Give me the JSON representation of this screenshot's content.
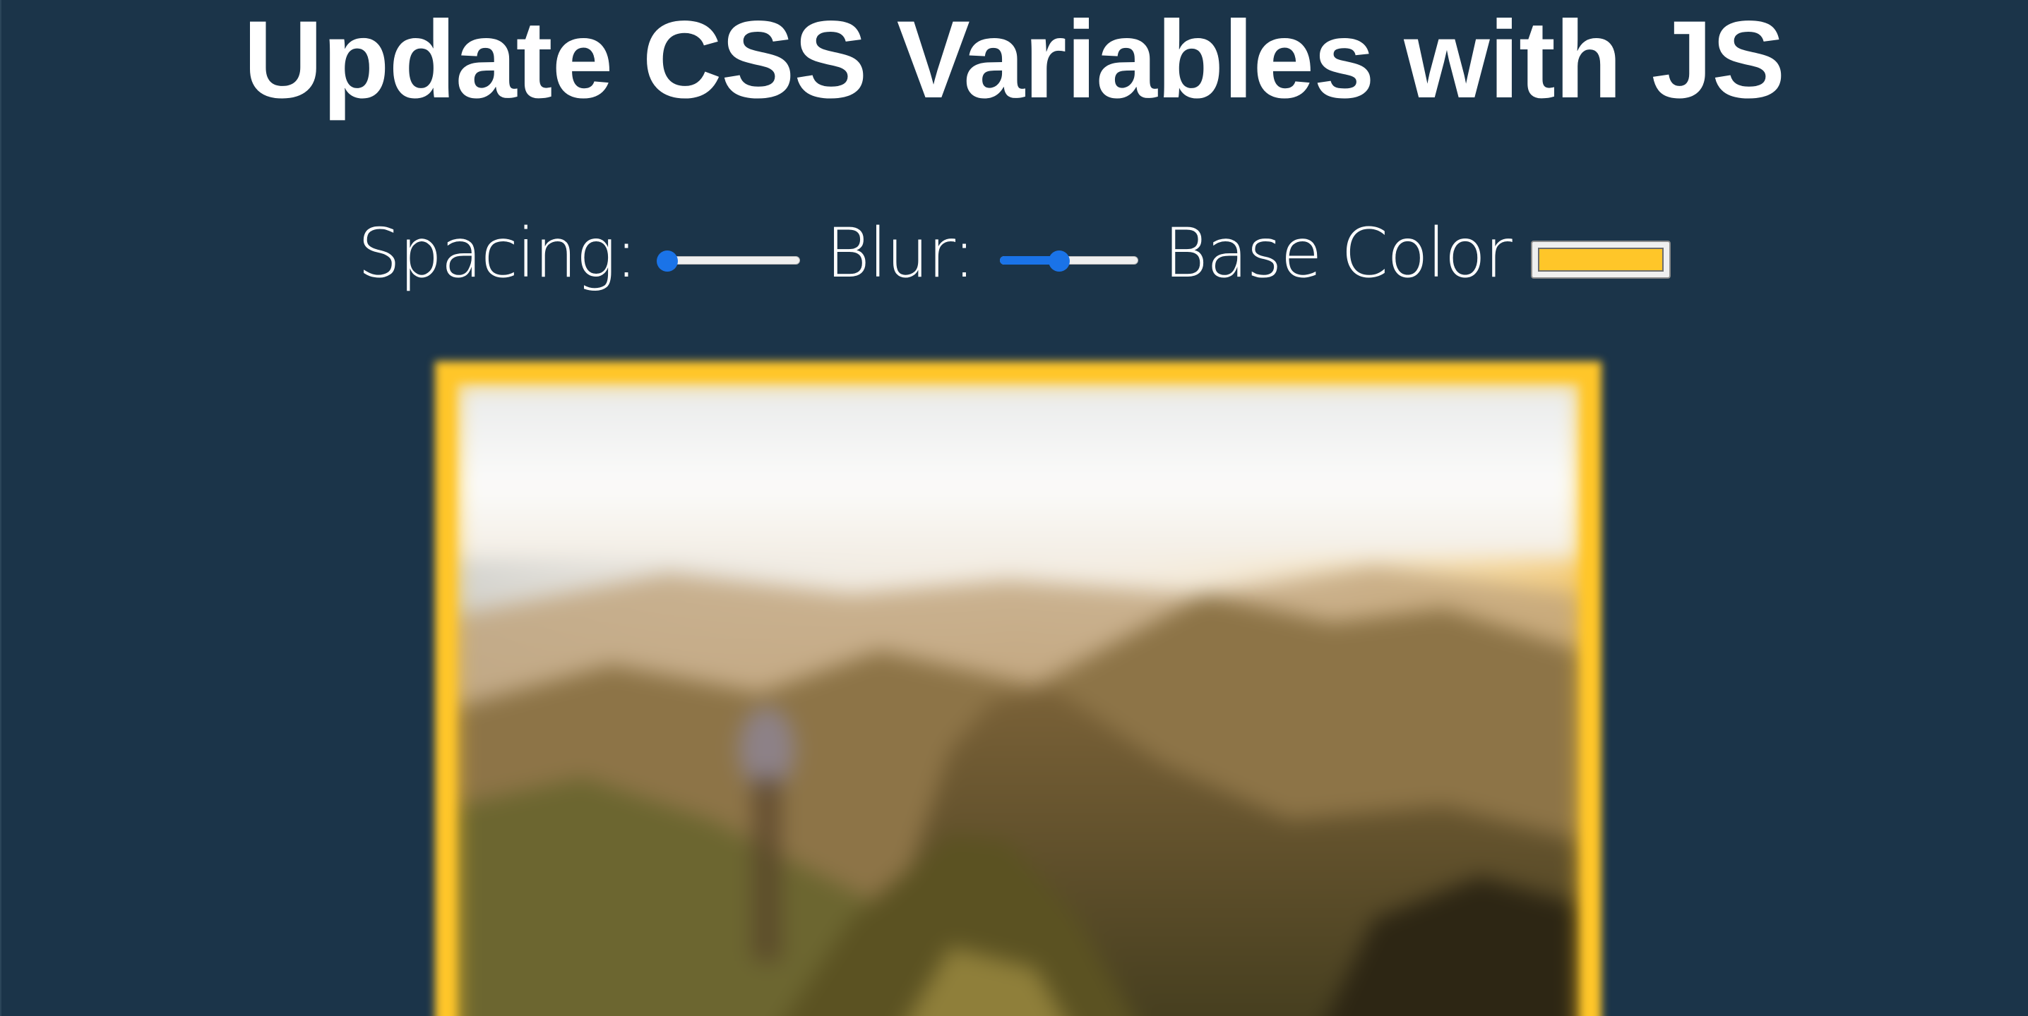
{
  "page": {
    "title": "Update CSS Variables with JS"
  },
  "controls": {
    "spacing": {
      "label": "Spacing:",
      "value_fraction": 0.0
    },
    "blur": {
      "label": "Blur:",
      "value_fraction": 0.42
    },
    "base_color": {
      "label": "Base Color",
      "value": "#ffc629"
    }
  },
  "image": {
    "description_icon": "mountain-landscape-photo"
  },
  "colors": {
    "background": "#1b3449",
    "text": "#ffffff",
    "accent": "#1a73e8",
    "base": "#ffc629"
  }
}
